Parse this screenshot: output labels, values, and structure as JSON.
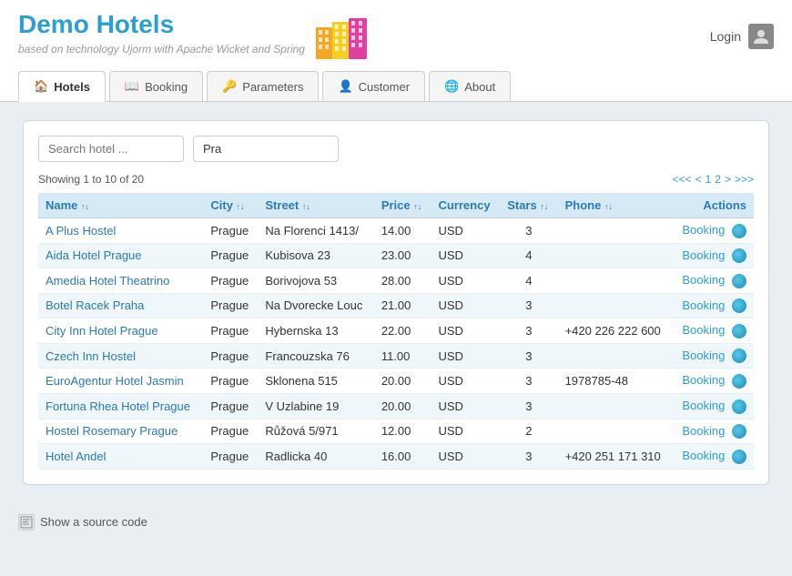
{
  "header": {
    "title": "Demo Hotels",
    "tagline": "based on technology Ujorm with Apache Wicket and Spring",
    "login_label": "Login"
  },
  "nav": {
    "tabs": [
      {
        "id": "hotels",
        "label": "Hotels",
        "active": true,
        "icon": "home"
      },
      {
        "id": "booking",
        "label": "Booking",
        "active": false,
        "icon": "book"
      },
      {
        "id": "parameters",
        "label": "Parameters",
        "active": false,
        "icon": "key"
      },
      {
        "id": "customer",
        "label": "Customer",
        "active": false,
        "icon": "person"
      },
      {
        "id": "about",
        "label": "About",
        "active": false,
        "icon": "globe"
      }
    ]
  },
  "search": {
    "placeholder": "Search hotel ...",
    "value": "Pra"
  },
  "pagination": {
    "info": "Showing 1 to 10 of 20",
    "first": "<<<",
    "prev": "<",
    "page1": "1",
    "page2": "2",
    "next": ">",
    "last": ">>>"
  },
  "table": {
    "columns": [
      {
        "id": "name",
        "label": "Name",
        "sortable": true
      },
      {
        "id": "city",
        "label": "City",
        "sortable": true
      },
      {
        "id": "street",
        "label": "Street",
        "sortable": true
      },
      {
        "id": "price",
        "label": "Price",
        "sortable": true
      },
      {
        "id": "currency",
        "label": "Currency",
        "sortable": false
      },
      {
        "id": "stars",
        "label": "Stars",
        "sortable": true
      },
      {
        "id": "phone",
        "label": "Phone",
        "sortable": true
      },
      {
        "id": "actions",
        "label": "Actions",
        "sortable": false
      }
    ],
    "rows": [
      {
        "name": "A Plus Hostel",
        "city": "Prague",
        "street": "Na Florenci 1413/",
        "price": "14.00",
        "currency": "USD",
        "stars": "3",
        "phone": "",
        "booking_label": "Booking"
      },
      {
        "name": "Aida Hotel Prague",
        "city": "Prague",
        "street": "Kubisova 23",
        "price": "23.00",
        "currency": "USD",
        "stars": "4",
        "phone": "",
        "booking_label": "Booking"
      },
      {
        "name": "Amedia Hotel Theatrino",
        "city": "Prague",
        "street": "Borivojova 53",
        "price": "28.00",
        "currency": "USD",
        "stars": "4",
        "phone": "",
        "booking_label": "Booking"
      },
      {
        "name": "Botel Racek Praha",
        "city": "Prague",
        "street": "Na Dvorecke Louc",
        "price": "21.00",
        "currency": "USD",
        "stars": "3",
        "phone": "",
        "booking_label": "Booking"
      },
      {
        "name": "City Inn Hotel Prague",
        "city": "Prague",
        "street": "Hybernska 13",
        "price": "22.00",
        "currency": "USD",
        "stars": "3",
        "phone": "+420 226 222 600",
        "booking_label": "Booking"
      },
      {
        "name": "Czech Inn Hostel",
        "city": "Prague",
        "street": "Francouzska 76",
        "price": "11.00",
        "currency": "USD",
        "stars": "3",
        "phone": "",
        "booking_label": "Booking"
      },
      {
        "name": "EuroAgentur Hotel Jasmin",
        "city": "Prague",
        "street": "Sklonena 515",
        "price": "20.00",
        "currency": "USD",
        "stars": "3",
        "phone": "1978785-48",
        "booking_label": "Booking"
      },
      {
        "name": "Fortuna Rhea Hotel Prague",
        "city": "Prague",
        "street": "V Uzlabine 19",
        "price": "20.00",
        "currency": "USD",
        "stars": "3",
        "phone": "",
        "booking_label": "Booking"
      },
      {
        "name": "Hostel Rosemary Prague",
        "city": "Prague",
        "street": "Růžová 5/971",
        "price": "12.00",
        "currency": "USD",
        "stars": "2",
        "phone": "",
        "booking_label": "Booking"
      },
      {
        "name": "Hotel Andel",
        "city": "Prague",
        "street": "Radlicka 40",
        "price": "16.00",
        "currency": "USD",
        "stars": "3",
        "phone": "+420 251 171 310",
        "booking_label": "Booking"
      }
    ]
  },
  "footer": {
    "source_label": "Show a source code"
  }
}
